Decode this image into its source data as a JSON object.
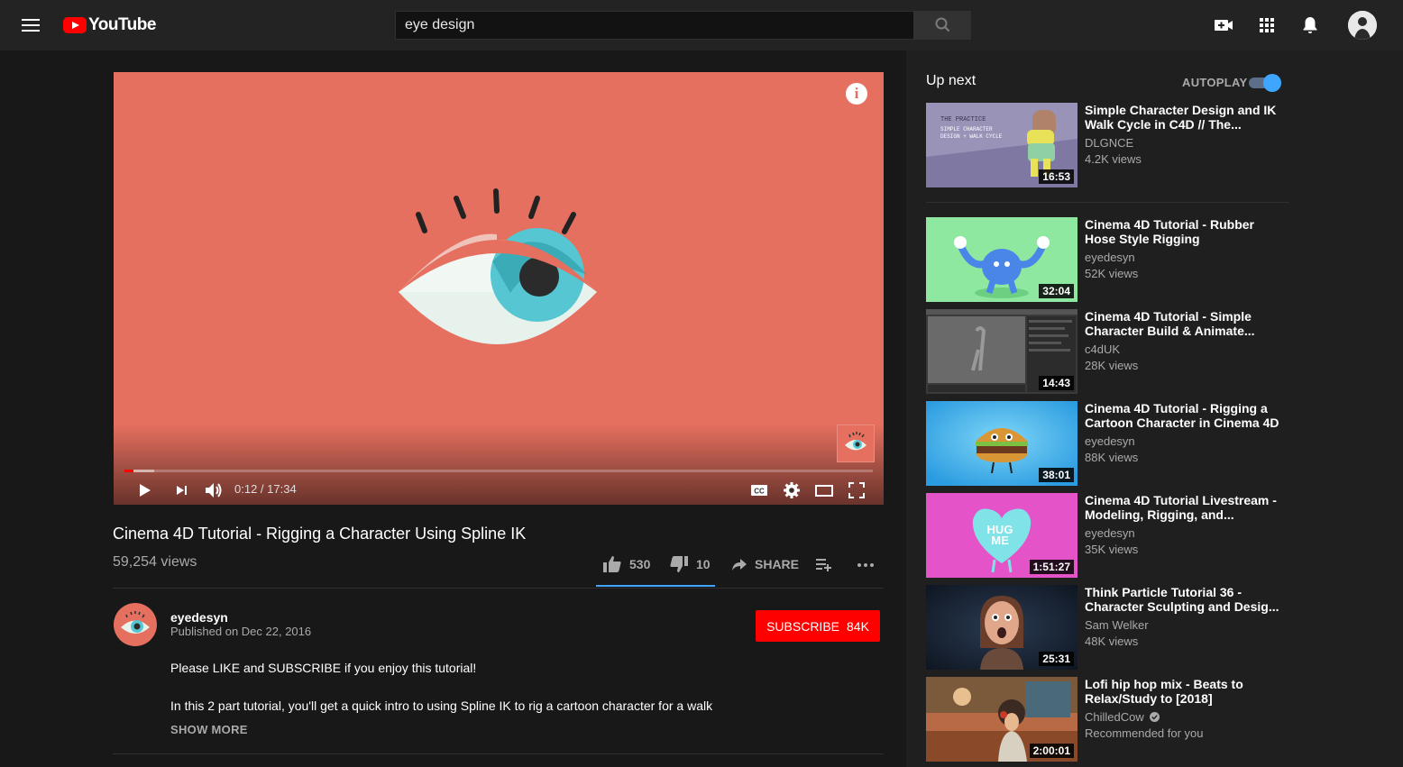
{
  "colors": {
    "accent": "#ff0000",
    "blue": "#3ea6ff",
    "player_bg": "#e6705f"
  },
  "header": {
    "logo_text": "YouTube",
    "search_value": "eye design"
  },
  "player": {
    "progress_fraction": 0.0115,
    "buffer_fraction": 0.04,
    "time": "0:12 / 17:34"
  },
  "video": {
    "title": "Cinema 4D Tutorial - Rigging a Character Using Spline IK",
    "views": "59,254 views",
    "likes": "530",
    "dislikes": "10",
    "share_label": "SHARE"
  },
  "channel": {
    "name": "eyedesyn",
    "published": "Published on Dec 22, 2016",
    "subscribe_label": "SUBSCRIBE",
    "subscribers": "84K"
  },
  "description": {
    "line1": "Please LIKE and SUBSCRIBE if you enjoy this tutorial!",
    "line2": "In this 2 part tutorial, you'll get a quick intro to using Spline IK to rig a cartoon character for a walk",
    "show_more": "SHOW MORE"
  },
  "sidebar": {
    "up_next": "Up next",
    "autoplay": "AUTOPLAY",
    "first_thumb_text": [
      "THE PRACTICE",
      "SIMPLE CHARACTER",
      "DESIGN + WALK CYCLE"
    ],
    "hug_me": [
      "HUG",
      "ME"
    ],
    "items": [
      {
        "title": "Simple Character Design and IK Walk Cycle in C4D // The...",
        "channel": "DLGNCE",
        "meta": "4.2K views",
        "duration": "16:53"
      },
      {
        "title": "Cinema 4D Tutorial - Rubber Hose Style Rigging",
        "channel": "eyedesyn",
        "meta": "52K views",
        "duration": "32:04"
      },
      {
        "title": "Cinema 4D Tutorial - Simple Character Build & Animate...",
        "channel": "c4dUK",
        "meta": "28K views",
        "duration": "14:43"
      },
      {
        "title": "Cinema 4D Tutorial - Rigging a Cartoon Character in Cinema 4D",
        "channel": "eyedesyn",
        "meta": "88K views",
        "duration": "38:01"
      },
      {
        "title": "Cinema 4D Tutorial Livestream - Modeling, Rigging, and...",
        "channel": "eyedesyn",
        "meta": "35K views",
        "duration": "1:51:27"
      },
      {
        "title": "Think Particle Tutorial 36 - Character Sculpting and Desig...",
        "channel": "Sam Welker",
        "meta": "48K views",
        "duration": "25:31"
      },
      {
        "title": "Lofi hip hop mix - Beats to Relax/Study to [2018]",
        "channel": "ChilledCow",
        "meta": "Recommended for you",
        "duration": "2:00:01"
      }
    ]
  }
}
